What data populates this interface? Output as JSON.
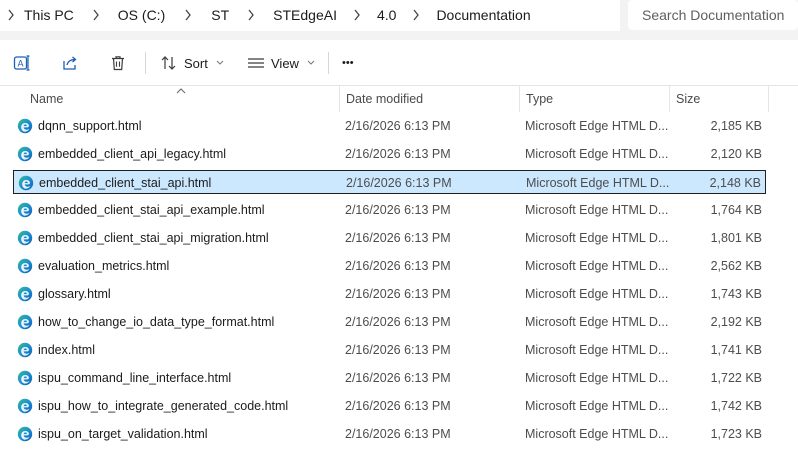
{
  "breadcrumb": [
    "This PC",
    "OS (C:)",
    "ST",
    "STEdgeAI",
    "4.0",
    "Documentation"
  ],
  "search": {
    "placeholder": "Search Documentation"
  },
  "toolbar": {
    "sort_label": "Sort",
    "view_label": "View",
    "more_label": "•••"
  },
  "columns": {
    "name": "Name",
    "date": "Date modified",
    "type": "Type",
    "size": "Size"
  },
  "files": [
    {
      "name": "dqnn_support.html",
      "date": "2/16/2026 6:13 PM",
      "type": "Microsoft Edge HTML D...",
      "size": "2,185 KB"
    },
    {
      "name": "embedded_client_api_legacy.html",
      "date": "2/16/2026 6:13 PM",
      "type": "Microsoft Edge HTML D...",
      "size": "2,120 KB"
    },
    {
      "name": "embedded_client_stai_api.html",
      "date": "2/16/2026 6:13 PM",
      "type": "Microsoft Edge HTML D...",
      "size": "2,148 KB"
    },
    {
      "name": "embedded_client_stai_api_example.html",
      "date": "2/16/2026 6:13 PM",
      "type": "Microsoft Edge HTML D...",
      "size": "1,764 KB"
    },
    {
      "name": "embedded_client_stai_api_migration.html",
      "date": "2/16/2026 6:13 PM",
      "type": "Microsoft Edge HTML D...",
      "size": "1,801 KB"
    },
    {
      "name": "evaluation_metrics.html",
      "date": "2/16/2026 6:13 PM",
      "type": "Microsoft Edge HTML D...",
      "size": "2,562 KB"
    },
    {
      "name": "glossary.html",
      "date": "2/16/2026 6:13 PM",
      "type": "Microsoft Edge HTML D...",
      "size": "1,743 KB"
    },
    {
      "name": "how_to_change_io_data_type_format.html",
      "date": "2/16/2026 6:13 PM",
      "type": "Microsoft Edge HTML D...",
      "size": "2,192 KB"
    },
    {
      "name": "index.html",
      "date": "2/16/2026 6:13 PM",
      "type": "Microsoft Edge HTML D...",
      "size": "1,741 KB"
    },
    {
      "name": "ispu_command_line_interface.html",
      "date": "2/16/2026 6:13 PM",
      "type": "Microsoft Edge HTML D...",
      "size": "1,722 KB"
    },
    {
      "name": "ispu_how_to_integrate_generated_code.html",
      "date": "2/16/2026 6:13 PM",
      "type": "Microsoft Edge HTML D...",
      "size": "1,742 KB"
    },
    {
      "name": "ispu_on_target_validation.html",
      "date": "2/16/2026 6:13 PM",
      "type": "Microsoft Edge HTML D...",
      "size": "1,723 KB"
    }
  ],
  "selected_index": 2,
  "icons": {
    "file": "edge-html-file-icon",
    "toolbar": [
      "rename-icon",
      "share-icon",
      "delete-icon",
      "sort-icon",
      "view-icon",
      "more-icon"
    ]
  },
  "colors": {
    "selection": "#cce8ff",
    "selection_border": "#202020",
    "edge_blue": "#0f6cbd",
    "edge_green": "#35c08f"
  }
}
